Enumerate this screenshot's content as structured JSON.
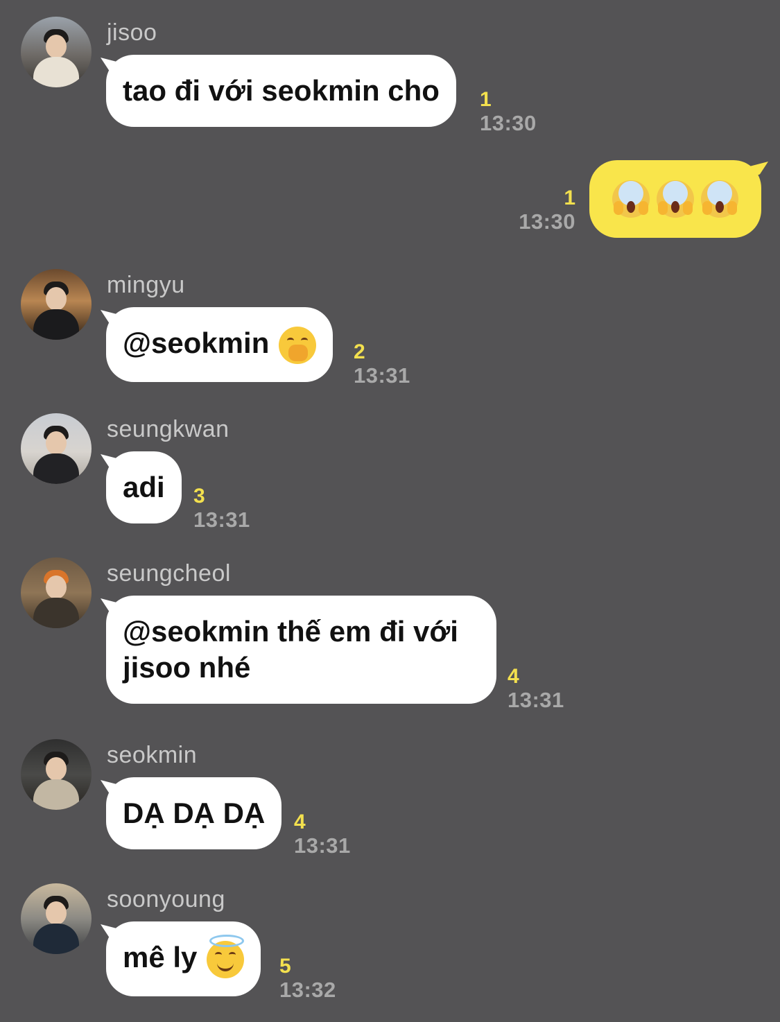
{
  "messages": [
    {
      "sender": "jisoo",
      "text": "tao đi với seokmin cho",
      "count": "1",
      "time": "13:30"
    },
    {
      "outgoing": true,
      "emoji_text": "😱😱😱",
      "count": "1",
      "time": "13:30"
    },
    {
      "sender": "mingyu",
      "text": "@seokmin",
      "emoji": "🤭",
      "count": "2",
      "time": "13:31"
    },
    {
      "sender": "seungkwan",
      "text": "adi",
      "count": "3",
      "time": "13:31"
    },
    {
      "sender": "seungcheol",
      "text": "@seokmin thế em đi với jisoo nhé",
      "count": "4",
      "time": "13:31"
    },
    {
      "sender": "seokmin",
      "text": "DẠ DẠ DẠ",
      "count": "4",
      "time": "13:31"
    },
    {
      "sender": "soonyoung",
      "text": "mê ly",
      "emoji": "😇",
      "count": "5",
      "time": "13:32"
    }
  ],
  "colors": {
    "background": "#545355",
    "bubble_in": "#ffffff",
    "bubble_out": "#f9e54b",
    "unread_count": "#f3e04e",
    "timestamp": "#a9a9a9",
    "sender_name": "#c9c9c9"
  }
}
